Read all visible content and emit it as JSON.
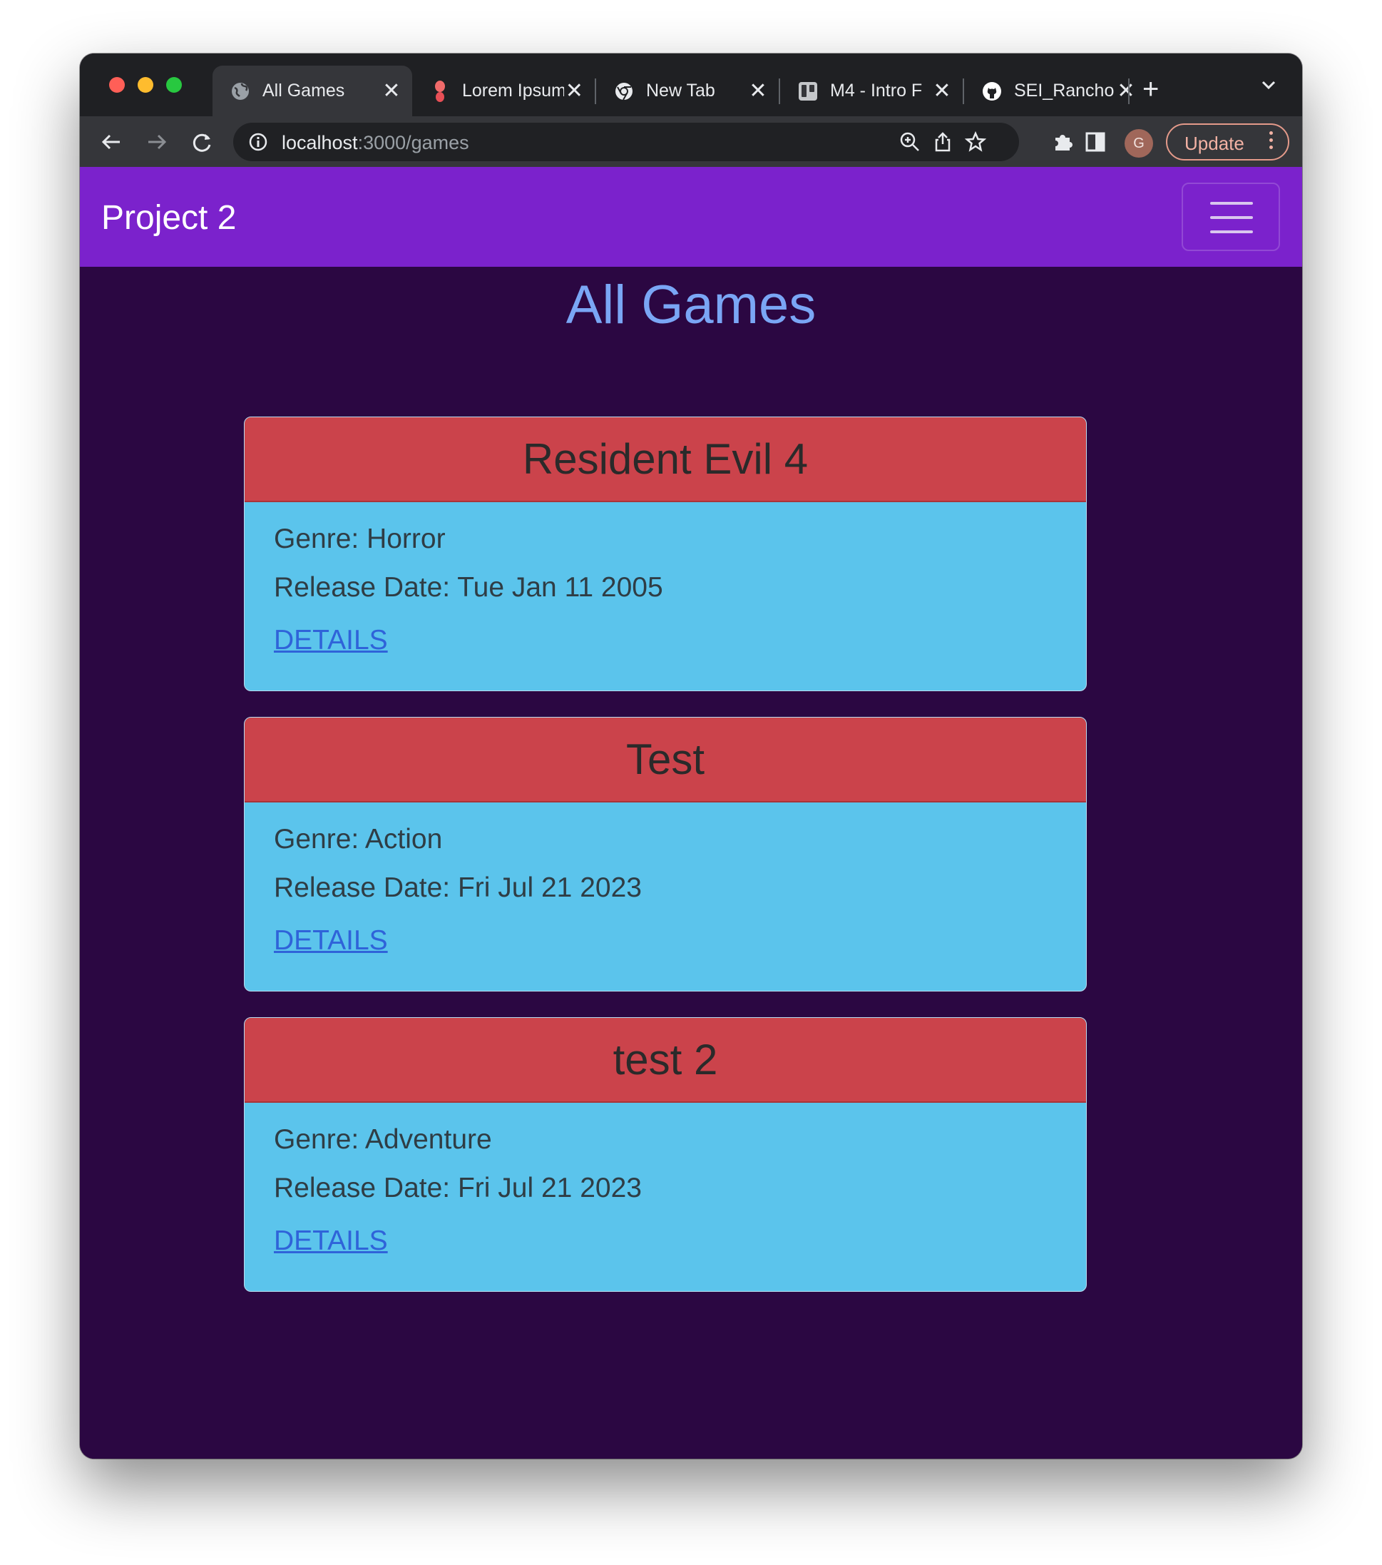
{
  "browser": {
    "tabs": [
      {
        "label": "All Games",
        "icon": "globe-icon",
        "active": true
      },
      {
        "label": "Lorem Ipsum",
        "icon": "ipsum-favicon-icon",
        "active": false
      },
      {
        "label": "New Tab",
        "icon": "chrome-icon",
        "active": false
      },
      {
        "label": "M4 - Intro F",
        "icon": "trello-icon",
        "active": false
      },
      {
        "label": "SEI_Rancho",
        "icon": "github-icon",
        "active": false
      }
    ],
    "tab_close_glyph": "✕",
    "new_tab_glyph": "+",
    "url_host": "localhost",
    "url_path": ":3000/games",
    "profile_initial": "G",
    "update_label": "Update"
  },
  "app": {
    "brand": "Project 2",
    "heading": "All Games",
    "games": [
      {
        "title": "Resident Evil 4",
        "genre": "Genre: Horror",
        "release": "Release Date: Tue Jan 11 2005",
        "link": "DETAILS"
      },
      {
        "title": "Test",
        "genre": "Genre: Action",
        "release": "Release Date: Fri Jul 21 2023",
        "link": "DETAILS"
      },
      {
        "title": "test 2",
        "genre": "Genre: Adventure",
        "release": "Release Date: Fri Jul 21 2023",
        "link": "DETAILS"
      }
    ]
  },
  "colors": {
    "navbar": "#7b22cc",
    "page_background": "#2b0742",
    "heading": "#7aa6f5",
    "card_header": "#cb434b",
    "card_body": "#5bc4ec",
    "link": "#2f63d9"
  }
}
